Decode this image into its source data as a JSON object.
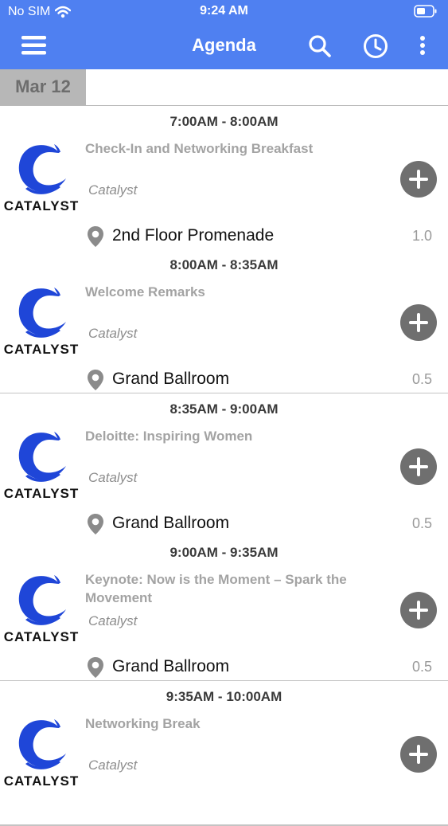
{
  "status_bar": {
    "carrier": "No SIM",
    "time": "9:24 AM",
    "icons": [
      "wifi-icon",
      "battery-icon"
    ]
  },
  "nav": {
    "title": "Agenda",
    "icons": [
      "hamburger-menu-icon",
      "search-icon",
      "clock-icon",
      "more-vertical-icon"
    ]
  },
  "date_tab": "Mar 12",
  "logo_word": "CATALYST",
  "sessions": [
    {
      "time": "7:00AM - 8:00AM",
      "title": "Check-In and Networking Breakfast",
      "track": "Catalyst",
      "location": "2nd Floor Promenade",
      "credit": "1.0"
    },
    {
      "time": "8:00AM - 8:35AM",
      "title": "Welcome Remarks",
      "track": "Catalyst",
      "location": "Grand Ballroom",
      "credit": "0.5"
    },
    {
      "time": "8:35AM - 9:00AM",
      "title": "Deloitte: Inspiring Women",
      "track": "Catalyst",
      "location": "Grand Ballroom",
      "credit": "0.5"
    },
    {
      "time": "9:00AM - 9:35AM",
      "title": "Keynote: Now is the Moment – Spark the Movement",
      "track": "Catalyst",
      "location": "Grand Ballroom",
      "credit": "0.5"
    },
    {
      "time": "9:35AM - 10:00AM",
      "title": "Networking Break",
      "track": "Catalyst",
      "location": "",
      "credit": ""
    }
  ],
  "colors": {
    "brand_blue": "#4f80f1",
    "logo_blue": "#1f46d8",
    "date_tab_gray": "#b7b7b7",
    "add_button_gray": "#6f6f6f"
  }
}
